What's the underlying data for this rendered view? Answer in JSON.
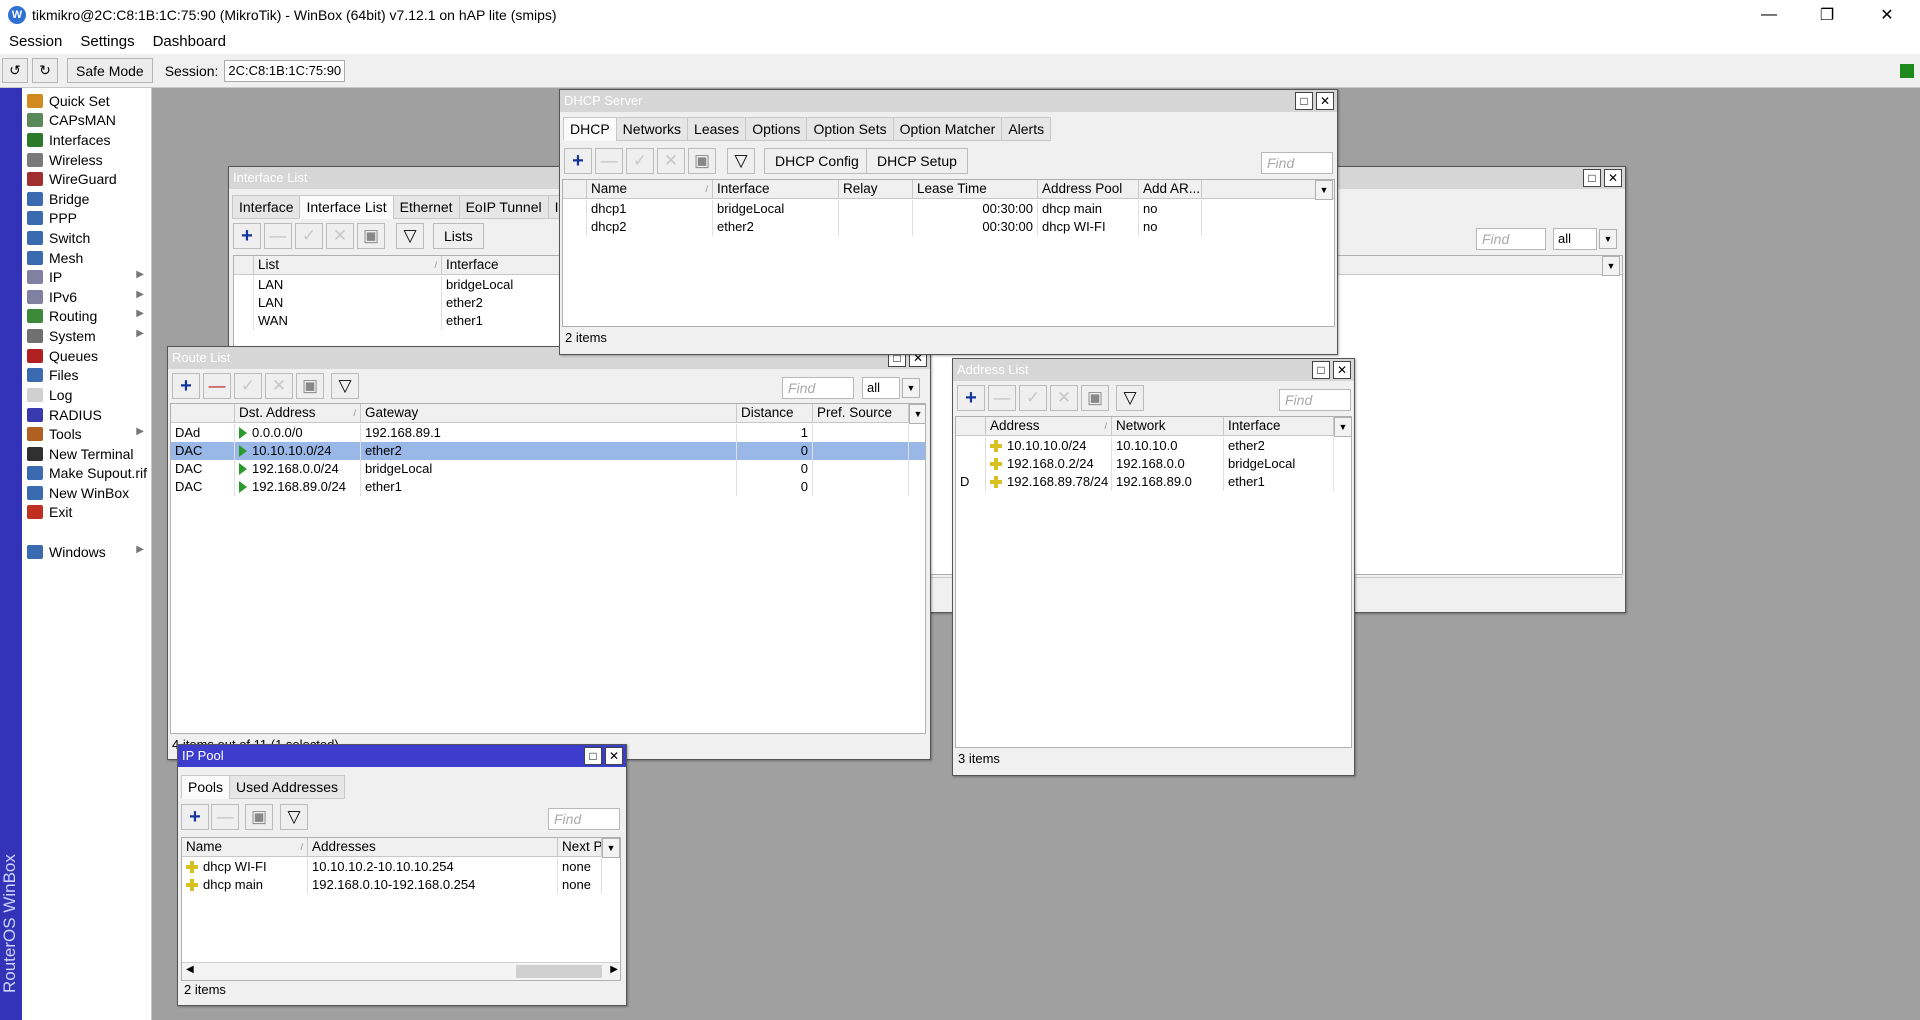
{
  "window": {
    "title": "tikmikro@2C:C8:1B:1C:75:90 (MikroTik) - WinBox (64bit) v7.12.1 on hAP lite (smips)"
  },
  "menu": [
    "Session",
    "Settings",
    "Dashboard"
  ],
  "toolbar": {
    "safe_mode": "Safe Mode",
    "session_label": "Session:",
    "session_value": "2C:C8:1B:1C:75:90"
  },
  "sidebar": {
    "brand": "RouterOS WinBox",
    "items": [
      {
        "label": "Quick Set",
        "icon": "quickset-icon",
        "color": "#d08a20"
      },
      {
        "label": "CAPsMAN",
        "icon": "capsman-icon",
        "color": "#5a8a5a"
      },
      {
        "label": "Interfaces",
        "icon": "interfaces-icon",
        "color": "#2a7a2a"
      },
      {
        "label": "Wireless",
        "icon": "wireless-icon",
        "color": "#7a7a7a"
      },
      {
        "label": "WireGuard",
        "icon": "wireguard-icon",
        "color": "#a03030"
      },
      {
        "label": "Bridge",
        "icon": "bridge-icon",
        "color": "#3a6ab0"
      },
      {
        "label": "PPP",
        "icon": "ppp-icon",
        "color": "#3a6ab0"
      },
      {
        "label": "Switch",
        "icon": "switch-icon",
        "color": "#3a6ab0"
      },
      {
        "label": "Mesh",
        "icon": "mesh-icon",
        "color": "#3a6ab0"
      },
      {
        "label": "IP",
        "icon": "ip-icon",
        "color": "#8080a0",
        "arrow": true
      },
      {
        "label": "IPv6",
        "icon": "ipv6-icon",
        "color": "#8080a0",
        "arrow": true
      },
      {
        "label": "Routing",
        "icon": "routing-icon",
        "color": "#3a8a3a",
        "arrow": true
      },
      {
        "label": "System",
        "icon": "system-icon",
        "color": "#707070",
        "arrow": true
      },
      {
        "label": "Queues",
        "icon": "queues-icon",
        "color": "#b02020"
      },
      {
        "label": "Files",
        "icon": "files-icon",
        "color": "#3a6ab0"
      },
      {
        "label": "Log",
        "icon": "log-icon",
        "color": "#d0d0d0"
      },
      {
        "label": "RADIUS",
        "icon": "radius-icon",
        "color": "#3a3ab0"
      },
      {
        "label": "Tools",
        "icon": "tools-icon",
        "color": "#b06020",
        "arrow": true
      },
      {
        "label": "New Terminal",
        "icon": "terminal-icon",
        "color": "#303030"
      },
      {
        "label": "Make Supout.rif",
        "icon": "supout-icon",
        "color": "#3a6ab0"
      },
      {
        "label": "New WinBox",
        "icon": "newwinbox-icon",
        "color": "#3a6ab0"
      },
      {
        "label": "Exit",
        "icon": "exit-icon",
        "color": "#c03020"
      },
      {
        "label": "Windows",
        "icon": "windows-icon",
        "color": "#3a6ab0",
        "arrow": true
      }
    ]
  },
  "interface_list": {
    "title": "Interface List",
    "tabs": [
      "Interface",
      "Interface List",
      "Ethernet",
      "EoIP Tunnel",
      "IP"
    ],
    "lists_btn": "Lists",
    "find": "Find",
    "filter": "all",
    "columns": [
      "List",
      "Interface"
    ],
    "rows": [
      [
        "LAN",
        "bridgeLocal"
      ],
      [
        "LAN",
        "ether2"
      ],
      [
        "WAN",
        "ether1"
      ]
    ]
  },
  "dhcp": {
    "title": "DHCP Server",
    "tabs": [
      "DHCP",
      "Networks",
      "Leases",
      "Options",
      "Option Sets",
      "Option Matcher",
      "Alerts"
    ],
    "config_btn": "DHCP Config",
    "setup_btn": "DHCP Setup",
    "find": "Find",
    "columns": [
      "Name",
      "Interface",
      "Relay",
      "Lease Time",
      "Address Pool",
      "Add AR..."
    ],
    "rows": [
      [
        "dhcp1",
        "bridgeLocal",
        "",
        "00:30:00",
        "dhcp main",
        "no"
      ],
      [
        "dhcp2",
        "ether2",
        "",
        "00:30:00",
        "dhcp WI-FI",
        "no"
      ]
    ],
    "status": "2 items"
  },
  "route": {
    "title": "Route List",
    "find": "Find",
    "filter": "all",
    "columns": [
      "",
      "Dst. Address",
      "Gateway",
      "Distance",
      "Pref. Source"
    ],
    "rows": [
      [
        "DAd",
        "0.0.0.0/0",
        "192.168.89.1",
        "1",
        ""
      ],
      [
        "DAC",
        "10.10.10.0/24",
        "ether2",
        "0",
        ""
      ],
      [
        "DAC",
        "192.168.0.0/24",
        "bridgeLocal",
        "0",
        ""
      ],
      [
        "DAC",
        "192.168.89.0/24",
        "ether1",
        "0",
        ""
      ]
    ],
    "status": "4 items out of 11 (1 selected)"
  },
  "address": {
    "title": "Address List",
    "find": "Find",
    "columns": [
      "",
      "Address",
      "Network",
      "Interface"
    ],
    "rows": [
      [
        "",
        "10.10.10.0/24",
        "10.10.10.0",
        "ether2"
      ],
      [
        "",
        "192.168.0.2/24",
        "192.168.0.0",
        "bridgeLocal"
      ],
      [
        "D",
        "192.168.89.78/24",
        "192.168.89.0",
        "ether1"
      ]
    ],
    "status": "3 items"
  },
  "pool": {
    "title": "IP Pool",
    "tabs": [
      "Pools",
      "Used Addresses"
    ],
    "find": "Find",
    "columns": [
      "Name",
      "Addresses",
      "Next Po"
    ],
    "rows": [
      [
        "dhcp WI-FI",
        "10.10.10.2-10.10.10.254",
        "none"
      ],
      [
        "dhcp main",
        "192.168.0.10-192.168.0.254",
        "none"
      ]
    ],
    "status": "2 items"
  }
}
